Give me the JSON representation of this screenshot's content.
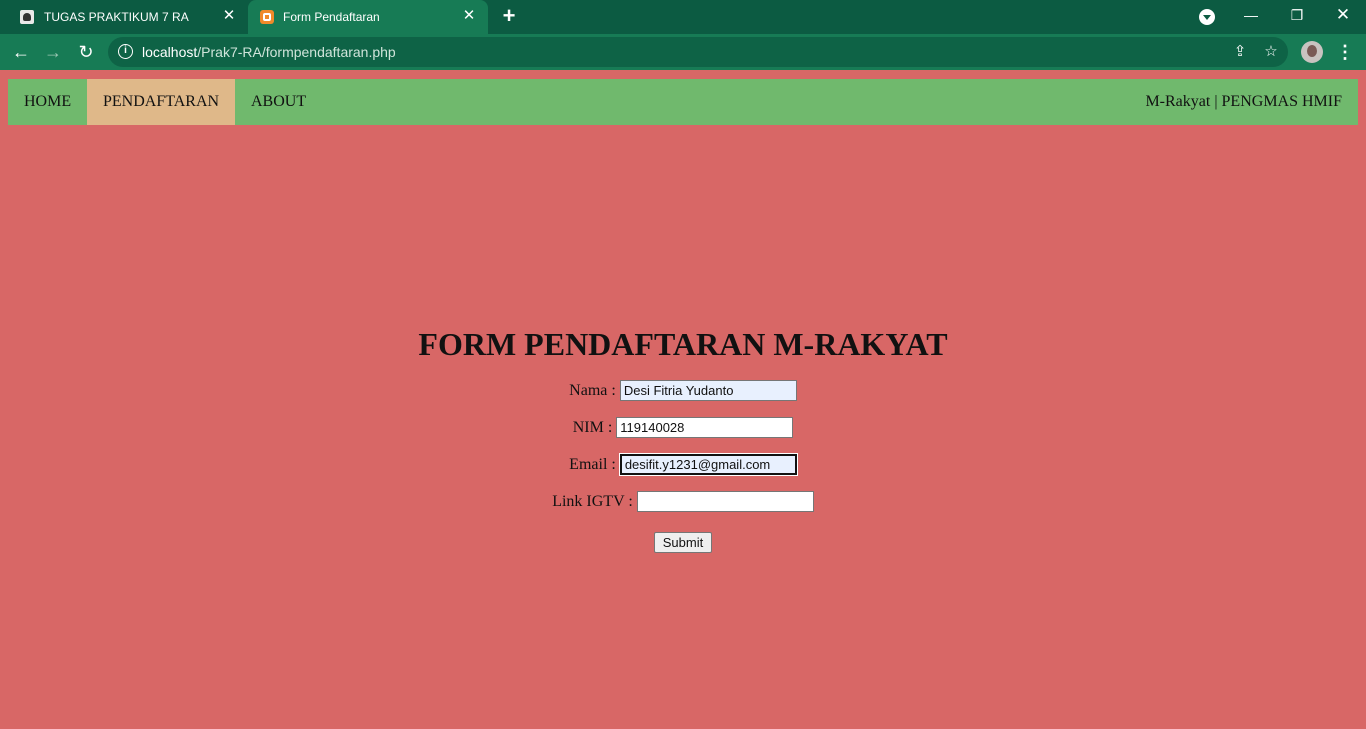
{
  "browser": {
    "tabs": [
      {
        "title": "TUGAS PRAKTIKUM 7 RA",
        "active": false
      },
      {
        "title": "Form Pendaftaran",
        "active": true
      }
    ],
    "url_host": "localhost",
    "url_path": "/Prak7-RA/formpendaftaran.php"
  },
  "navbar": {
    "items": [
      {
        "label": "HOME",
        "active": false
      },
      {
        "label": "PENDAFTARAN",
        "active": true
      },
      {
        "label": "ABOUT",
        "active": false
      }
    ],
    "brand": "M-Rakyat | PENGMAS HMIF"
  },
  "form": {
    "title": "FORM PENDAFTARAN M-RAKYAT",
    "fields": [
      {
        "label": "Nama :",
        "value": "Desi Fitria Yudanto"
      },
      {
        "label": "NIM :",
        "value": "119140028"
      },
      {
        "label": "Email :",
        "value": "desifit.y1231@gmail.com"
      },
      {
        "label": "Link IGTV :",
        "value": ""
      }
    ],
    "submit_label": "Submit"
  },
  "colors": {
    "page_background": "#d86766",
    "navbar": "#70b96d",
    "navbar_active": "#dfb889",
    "browser_frame": "#0c5b42",
    "browser_toolbar": "#177b55"
  }
}
